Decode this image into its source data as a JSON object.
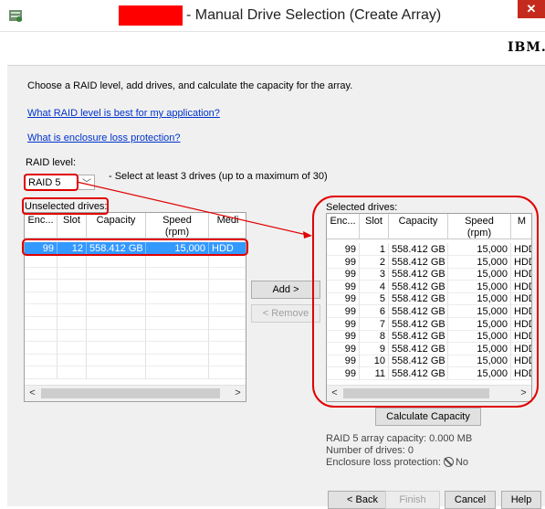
{
  "window": {
    "title": "- Manual Drive Selection (Create Array)",
    "close_glyph": "✕"
  },
  "brand": {
    "logo": "IBM."
  },
  "instructions": "Choose a RAID level, add drives, and calculate the capacity for the array.",
  "links": {
    "raid_help": "What RAID level is best for my application?",
    "enclosure_help": "What is enclosure loss protection?"
  },
  "raid": {
    "label": "RAID level:",
    "selected": "RAID 5",
    "hint": "- Select at least 3 drives (up to a maximum of 30)"
  },
  "unselected": {
    "label": "Unselected drives:",
    "columns": [
      "Enc...",
      "Slot",
      "Capacity",
      "Speed\n(rpm)",
      "Medi"
    ],
    "rows": [
      {
        "enc": "99",
        "slot": "12",
        "capacity": "558.412 GB",
        "speed": "15,000",
        "media": "HDD"
      }
    ]
  },
  "selected": {
    "label": "Selected drives:",
    "columns": [
      "Enc...",
      "Slot",
      "Capacity",
      "Speed\n(rpm)",
      "M"
    ],
    "rows": [
      {
        "enc": "99",
        "slot": "1",
        "capacity": "558.412 GB",
        "speed": "15,000",
        "media": "HDD"
      },
      {
        "enc": "99",
        "slot": "2",
        "capacity": "558.412 GB",
        "speed": "15,000",
        "media": "HDD"
      },
      {
        "enc": "99",
        "slot": "3",
        "capacity": "558.412 GB",
        "speed": "15,000",
        "media": "HDD"
      },
      {
        "enc": "99",
        "slot": "4",
        "capacity": "558.412 GB",
        "speed": "15,000",
        "media": "HDD"
      },
      {
        "enc": "99",
        "slot": "5",
        "capacity": "558.412 GB",
        "speed": "15,000",
        "media": "HDD"
      },
      {
        "enc": "99",
        "slot": "6",
        "capacity": "558.412 GB",
        "speed": "15,000",
        "media": "HDD"
      },
      {
        "enc": "99",
        "slot": "7",
        "capacity": "558.412 GB",
        "speed": "15,000",
        "media": "HDD"
      },
      {
        "enc": "99",
        "slot": "8",
        "capacity": "558.412 GB",
        "speed": "15,000",
        "media": "HDD"
      },
      {
        "enc": "99",
        "slot": "9",
        "capacity": "558.412 GB",
        "speed": "15,000",
        "media": "HDD"
      },
      {
        "enc": "99",
        "slot": "10",
        "capacity": "558.412 GB",
        "speed": "15,000",
        "media": "HDD"
      },
      {
        "enc": "99",
        "slot": "11",
        "capacity": "558.412 GB",
        "speed": "15,000",
        "media": "HDD"
      }
    ]
  },
  "buttons": {
    "add": "Add >",
    "remove": "< Remove",
    "calculate": "Calculate Capacity",
    "back": "< Back",
    "finish": "Finish",
    "cancel": "Cancel",
    "help": "Help"
  },
  "capacity": {
    "array_capacity": "RAID 5 array capacity: 0.000 MB",
    "drive_count": "Number of drives: 0",
    "enclosure_loss_label": "Enclosure loss protection:",
    "enclosure_loss_value": "No"
  },
  "colors": {
    "annotation": "#e00000",
    "selection": "#3399ff",
    "link": "#0033cc",
    "redaction": "#ff0000"
  }
}
